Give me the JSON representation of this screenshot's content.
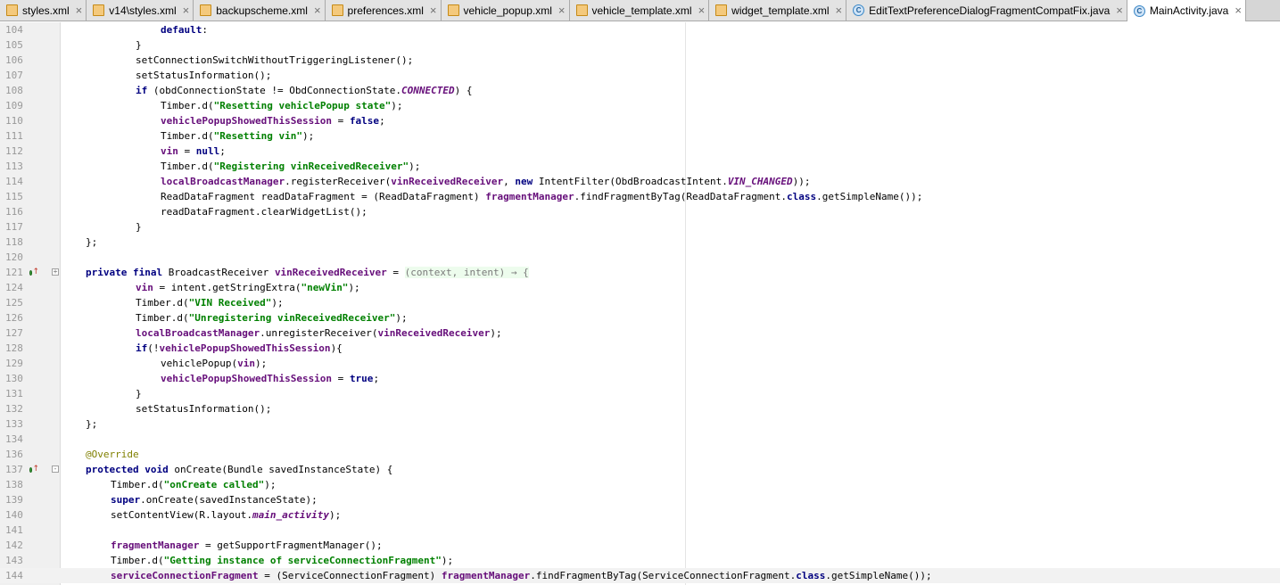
{
  "tabs": [
    {
      "label": "styles.xml",
      "icon": "xml-file-icon",
      "active": false
    },
    {
      "label": "v14\\styles.xml",
      "icon": "xml-file-icon",
      "active": false
    },
    {
      "label": "backupscheme.xml",
      "icon": "xml-file-icon",
      "active": false
    },
    {
      "label": "preferences.xml",
      "icon": "xml-file-icon",
      "active": false
    },
    {
      "label": "vehicle_popup.xml",
      "icon": "xml-file-icon",
      "active": false
    },
    {
      "label": "vehicle_template.xml",
      "icon": "xml-file-icon",
      "active": false
    },
    {
      "label": "widget_template.xml",
      "icon": "xml-file-icon",
      "active": false
    },
    {
      "label": "EditTextPreferenceDialogFragmentCompatFix.java",
      "icon": "java-class-icon",
      "active": false
    },
    {
      "label": "MainActivity.java",
      "icon": "java-class-icon",
      "active": true
    }
  ],
  "tab_close_glyph": "×",
  "java_icon_glyph": "C",
  "colors": {
    "keyword": "#000080",
    "string": "#008000",
    "field": "#660e7a",
    "annotation": "#808000",
    "line_number": "#999999",
    "gutter_bg": "#f0f0f0"
  },
  "editor": {
    "lines": [
      {
        "number": "104",
        "indent": 3,
        "tokens": [
          {
            "t": "default",
            "c": "kw"
          },
          {
            "t": ":"
          }
        ]
      },
      {
        "number": "105",
        "indent": 2,
        "tokens": [
          {
            "t": "}"
          }
        ]
      },
      {
        "number": "106",
        "indent": 2,
        "tokens": [
          {
            "t": "setConnectionSwitchWithoutTriggeringListener();"
          }
        ]
      },
      {
        "number": "107",
        "indent": 2,
        "tokens": [
          {
            "t": "setStatusInformation();"
          }
        ]
      },
      {
        "number": "108",
        "indent": 2,
        "tokens": [
          {
            "t": "if",
            "c": "kw"
          },
          {
            "t": " (obdConnectionState != ObdConnectionState."
          },
          {
            "t": "CONNECTED",
            "c": "cst"
          },
          {
            "t": ") {"
          }
        ]
      },
      {
        "number": "109",
        "indent": 3,
        "tokens": [
          {
            "t": "Timber.d("
          },
          {
            "t": "\"Resetting vehiclePopup state\"",
            "c": "str"
          },
          {
            "t": ");"
          }
        ]
      },
      {
        "number": "110",
        "indent": 3,
        "tokens": [
          {
            "t": "vehiclePopupShowedThisSession",
            "c": "fld"
          },
          {
            "t": " = "
          },
          {
            "t": "false",
            "c": "kw"
          },
          {
            "t": ";"
          }
        ]
      },
      {
        "number": "111",
        "indent": 3,
        "tokens": [
          {
            "t": "Timber.d("
          },
          {
            "t": "\"Resetting vin\"",
            "c": "str"
          },
          {
            "t": ");"
          }
        ]
      },
      {
        "number": "112",
        "indent": 3,
        "tokens": [
          {
            "t": "vin",
            "c": "fld"
          },
          {
            "t": " = "
          },
          {
            "t": "null",
            "c": "kw"
          },
          {
            "t": ";"
          }
        ]
      },
      {
        "number": "113",
        "indent": 3,
        "tokens": [
          {
            "t": "Timber.d("
          },
          {
            "t": "\"Registering vinReceivedReceiver\"",
            "c": "str"
          },
          {
            "t": ");"
          }
        ]
      },
      {
        "number": "114",
        "indent": 3,
        "tokens": [
          {
            "t": "localBroadcastManager",
            "c": "fld"
          },
          {
            "t": ".registerReceiver("
          },
          {
            "t": "vinReceivedReceiver",
            "c": "fld"
          },
          {
            "t": ", "
          },
          {
            "t": "new",
            "c": "kw"
          },
          {
            "t": " IntentFilter(ObdBroadcastIntent."
          },
          {
            "t": "VIN_CHANGED",
            "c": "cst"
          },
          {
            "t": "));"
          }
        ]
      },
      {
        "number": "115",
        "indent": 3,
        "tokens": [
          {
            "t": "ReadDataFragment readDataFragment = (ReadDataFragment) "
          },
          {
            "t": "fragmentManager",
            "c": "fld"
          },
          {
            "t": ".findFragmentByTag(ReadDataFragment."
          },
          {
            "t": "class",
            "c": "kw"
          },
          {
            "t": ".getSimpleName());"
          }
        ]
      },
      {
        "number": "116",
        "indent": 3,
        "tokens": [
          {
            "t": "readDataFragment.clearWidgetList();"
          }
        ]
      },
      {
        "number": "117",
        "indent": 2,
        "tokens": [
          {
            "t": "}"
          }
        ]
      },
      {
        "number": "118",
        "indent": 0,
        "tokens": [
          {
            "t": "};"
          }
        ]
      },
      {
        "number": "120",
        "indent": 0,
        "tokens": []
      },
      {
        "number": "121",
        "indent": 0,
        "impl": true,
        "fold": "+",
        "tokens": [
          {
            "t": "private final",
            "c": "kw"
          },
          {
            "t": " BroadcastReceiver "
          },
          {
            "t": "vinReceivedReceiver",
            "c": "fld"
          },
          {
            "t": " = "
          },
          {
            "t": "(context, intent) → {",
            "c": "lam"
          }
        ]
      },
      {
        "number": "124",
        "indent": 2,
        "tokens": [
          {
            "t": "vin",
            "c": "fld"
          },
          {
            "t": " = intent.getStringExtra("
          },
          {
            "t": "\"newVin\"",
            "c": "str"
          },
          {
            "t": ");"
          }
        ]
      },
      {
        "number": "125",
        "indent": 2,
        "tokens": [
          {
            "t": "Timber.d("
          },
          {
            "t": "\"VIN Received\"",
            "c": "str"
          },
          {
            "t": ");"
          }
        ]
      },
      {
        "number": "126",
        "indent": 2,
        "tokens": [
          {
            "t": "Timber.d("
          },
          {
            "t": "\"Unregistering vinReceivedReceiver\"",
            "c": "str"
          },
          {
            "t": ");"
          }
        ]
      },
      {
        "number": "127",
        "indent": 2,
        "tokens": [
          {
            "t": "localBroadcastManager",
            "c": "fld"
          },
          {
            "t": ".unregisterReceiver("
          },
          {
            "t": "vinReceivedReceiver",
            "c": "fld"
          },
          {
            "t": ");"
          }
        ]
      },
      {
        "number": "128",
        "indent": 2,
        "tokens": [
          {
            "t": "if",
            "c": "kw"
          },
          {
            "t": "(!"
          },
          {
            "t": "vehiclePopupShowedThisSession",
            "c": "fld"
          },
          {
            "t": "){"
          }
        ]
      },
      {
        "number": "129",
        "indent": 3,
        "tokens": [
          {
            "t": "vehiclePopup("
          },
          {
            "t": "vin",
            "c": "fld"
          },
          {
            "t": ");"
          }
        ]
      },
      {
        "number": "130",
        "indent": 3,
        "tokens": [
          {
            "t": "vehiclePopupShowedThisSession",
            "c": "fld"
          },
          {
            "t": " = "
          },
          {
            "t": "true",
            "c": "kw"
          },
          {
            "t": ";"
          }
        ]
      },
      {
        "number": "131",
        "indent": 2,
        "tokens": [
          {
            "t": "}"
          }
        ]
      },
      {
        "number": "132",
        "indent": 2,
        "tokens": [
          {
            "t": "setStatusInformation();"
          }
        ]
      },
      {
        "number": "133",
        "indent": 0,
        "tokens": [
          {
            "t": "};"
          }
        ]
      },
      {
        "number": "134",
        "indent": 0,
        "tokens": []
      },
      {
        "number": "136",
        "indent": 0,
        "tokens": [
          {
            "t": "@Override",
            "c": "ann"
          }
        ]
      },
      {
        "number": "137",
        "indent": 0,
        "impl": true,
        "fold": "-",
        "tokens": [
          {
            "t": "protected void",
            "c": "kw"
          },
          {
            "t": " onCreate(Bundle savedInstanceState) {"
          }
        ]
      },
      {
        "number": "138",
        "indent": 1,
        "tokens": [
          {
            "t": "Timber.d("
          },
          {
            "t": "\"onCreate called\"",
            "c": "str"
          },
          {
            "t": ");"
          }
        ]
      },
      {
        "number": "139",
        "indent": 1,
        "tokens": [
          {
            "t": "super",
            "c": "kw"
          },
          {
            "t": ".onCreate(savedInstanceState);"
          }
        ]
      },
      {
        "number": "140",
        "indent": 1,
        "tokens": [
          {
            "t": "setContentView(R.layout."
          },
          {
            "t": "main_activity",
            "c": "cst"
          },
          {
            "t": ");"
          }
        ]
      },
      {
        "number": "141",
        "indent": 0,
        "tokens": []
      },
      {
        "number": "142",
        "indent": 1,
        "tokens": [
          {
            "t": "fragmentManager",
            "c": "fld"
          },
          {
            "t": " = getSupportFragmentManager();"
          }
        ]
      },
      {
        "number": "143",
        "indent": 1,
        "tokens": [
          {
            "t": "Timber.d("
          },
          {
            "t": "\"Getting instance of serviceConnectionFragment\"",
            "c": "str"
          },
          {
            "t": ");"
          }
        ]
      },
      {
        "number": "144",
        "indent": 1,
        "current": true,
        "tokens": [
          {
            "t": "serviceConnectionFragment",
            "c": "fld"
          },
          {
            "t": " = (ServiceConnectionFragment) "
          },
          {
            "t": "fragmentManager",
            "c": "fld"
          },
          {
            "t": ".findFragmentByTag(ServiceConnectionFragment."
          },
          {
            "t": "class",
            "c": "kw"
          },
          {
            "t": ".getSimpleName());"
          }
        ]
      }
    ]
  }
}
